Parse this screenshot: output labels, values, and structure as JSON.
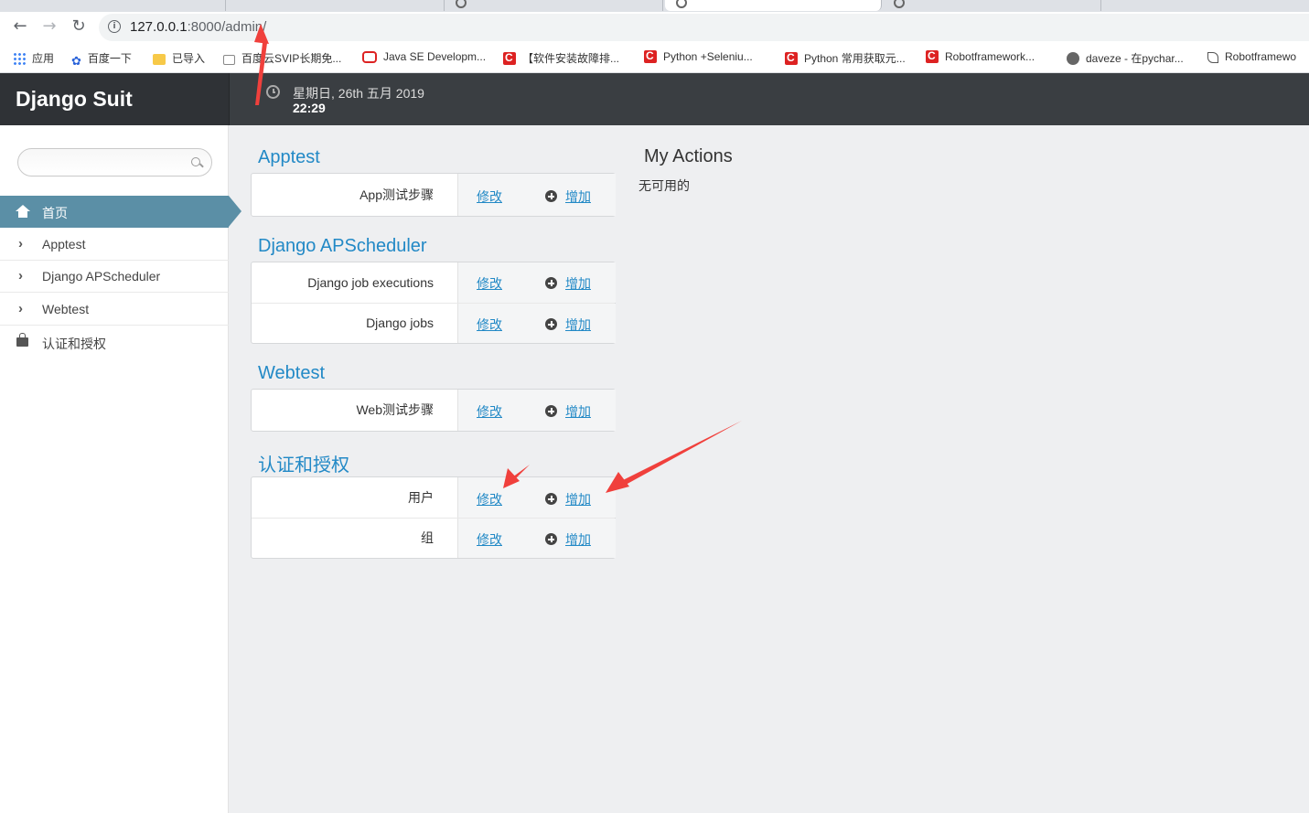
{
  "browser": {
    "url_host": "127.0.0.1",
    "url_rest": ":8000/admin/",
    "bookmarks": [
      {
        "label": "应用",
        "icon": "apps-grid-icon"
      },
      {
        "label": "百度一下",
        "icon": "baidu-paw-icon"
      },
      {
        "label": "已导入",
        "icon": "folder-icon"
      },
      {
        "label": "百度云SVIP长期免...",
        "icon": "cloud-icon"
      },
      {
        "label": "Java SE Developm...",
        "icon": "oracle-icon"
      },
      {
        "label": "【软件安装故障排...",
        "icon": "csdn-icon"
      },
      {
        "label": "Python +Seleniu...",
        "icon": "csdn-icon"
      },
      {
        "label": "Python 常用获取元...",
        "icon": "csdn-icon"
      },
      {
        "label": "Robotframework...",
        "icon": "csdn-icon"
      },
      {
        "label": "daveze - 在pychar...",
        "icon": "github-icon"
      },
      {
        "label": "Robotframewo",
        "icon": "script-icon"
      }
    ]
  },
  "header": {
    "brand": "Django Suit",
    "date": "星期日, 26th 五月 2019",
    "time": "22:29"
  },
  "sidebar": {
    "items": [
      {
        "label": "首页"
      },
      {
        "label": "Apptest"
      },
      {
        "label": "Django APScheduler"
      },
      {
        "label": "Webtest"
      },
      {
        "label": "认证和授权"
      }
    ]
  },
  "modules": [
    {
      "title": "Apptest",
      "rows": [
        {
          "name": "App测试步骤"
        }
      ]
    },
    {
      "title": "Django APScheduler",
      "rows": [
        {
          "name": "Django job executions"
        },
        {
          "name": "Django jobs"
        }
      ]
    },
    {
      "title": "Webtest",
      "rows": [
        {
          "name": "Web测试步骤"
        }
      ]
    },
    {
      "title": "认证和授权",
      "rows": [
        {
          "name": "用户"
        },
        {
          "name": "组"
        }
      ]
    }
  ],
  "labels": {
    "change": "修改",
    "add": "增加"
  },
  "actions": {
    "title": "My Actions",
    "none": "无可用的"
  },
  "colors": {
    "accent": "#2289c6",
    "active_menu": "#5b8fa6",
    "header": "#3a3e42",
    "annotation": "#f0403c"
  }
}
